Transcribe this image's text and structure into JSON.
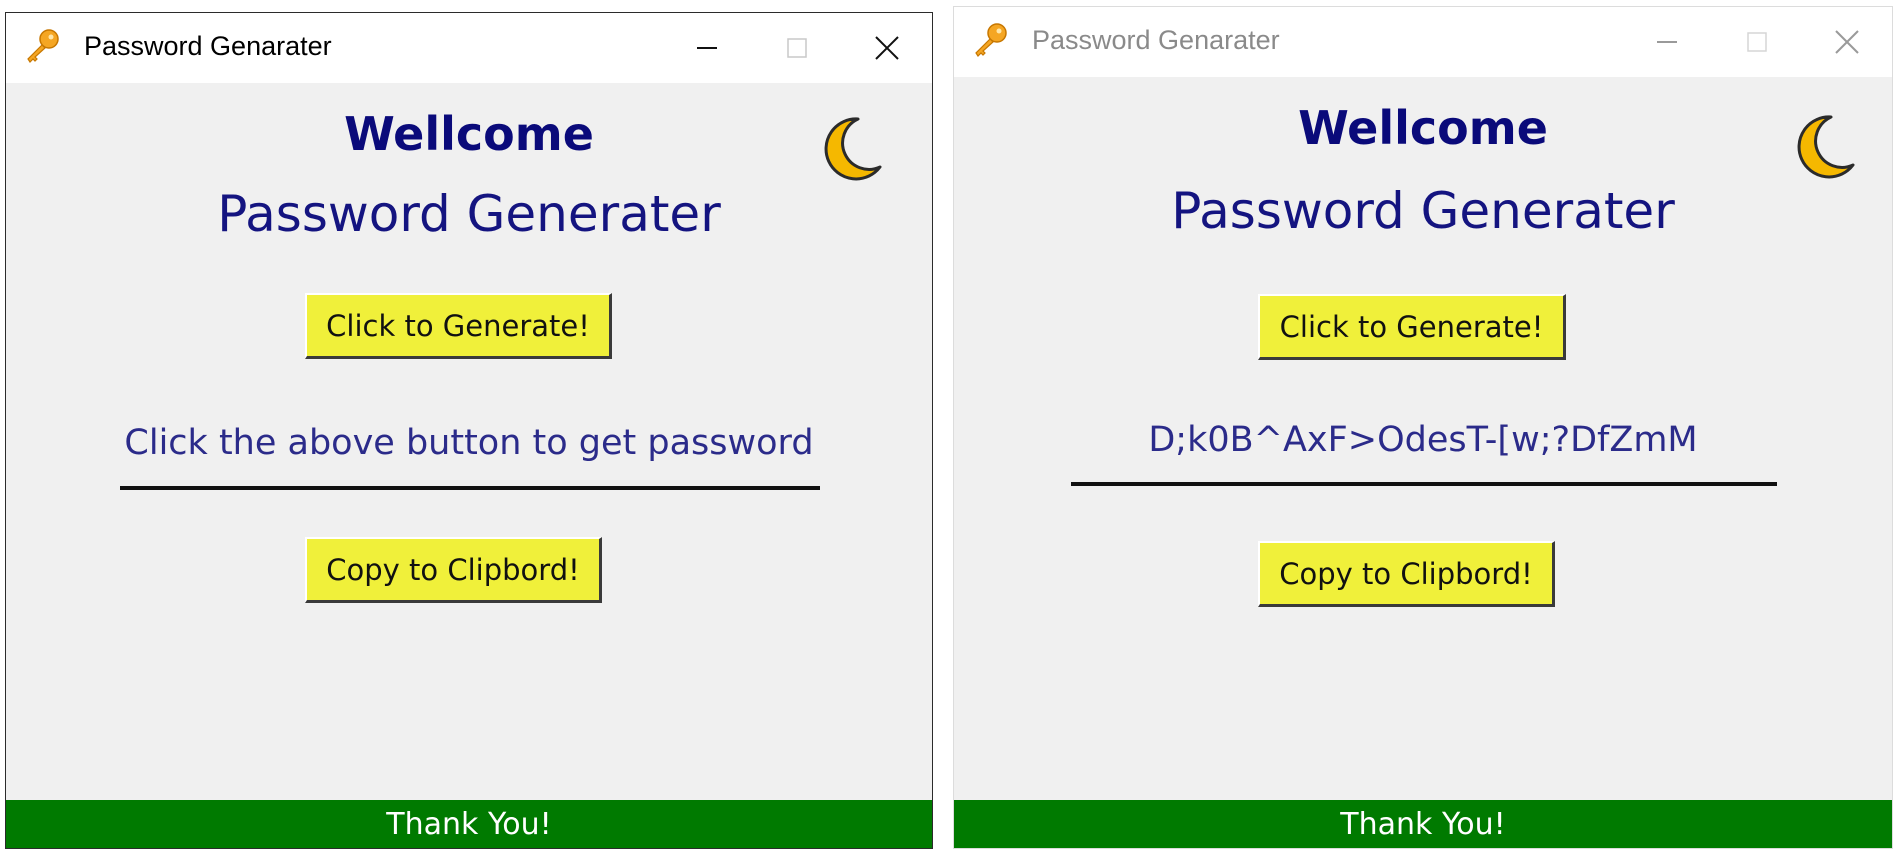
{
  "windows": [
    {
      "title": "Password Genarater",
      "welcome": "Wellcome",
      "subtitle": "Password Generater",
      "generate_button": "Click to Generate!",
      "output_text": "Click the above button to get password",
      "copy_button": "Copy to Clipbord!",
      "footer": "Thank You!",
      "icons": [
        "key-icon",
        "moon-icon",
        "minimize-icon",
        "maximize-icon",
        "close-icon"
      ]
    },
    {
      "title": "Password Genarater",
      "welcome": "Wellcome",
      "subtitle": "Password Generater",
      "generate_button": "Click to Generate!",
      "output_text": "D;k0B^AxF>OdesT-[w;?DfZmM",
      "copy_button": "Copy to Clipbord!",
      "footer": "Thank You!",
      "icons": [
        "key-icon",
        "moon-icon",
        "minimize-icon",
        "maximize-icon",
        "close-icon"
      ]
    }
  ],
  "colors": {
    "button_bg": "#f0f03a",
    "footer_bg": "#007a00",
    "heading": "#0a0a7a",
    "moon": "#f5b800"
  }
}
